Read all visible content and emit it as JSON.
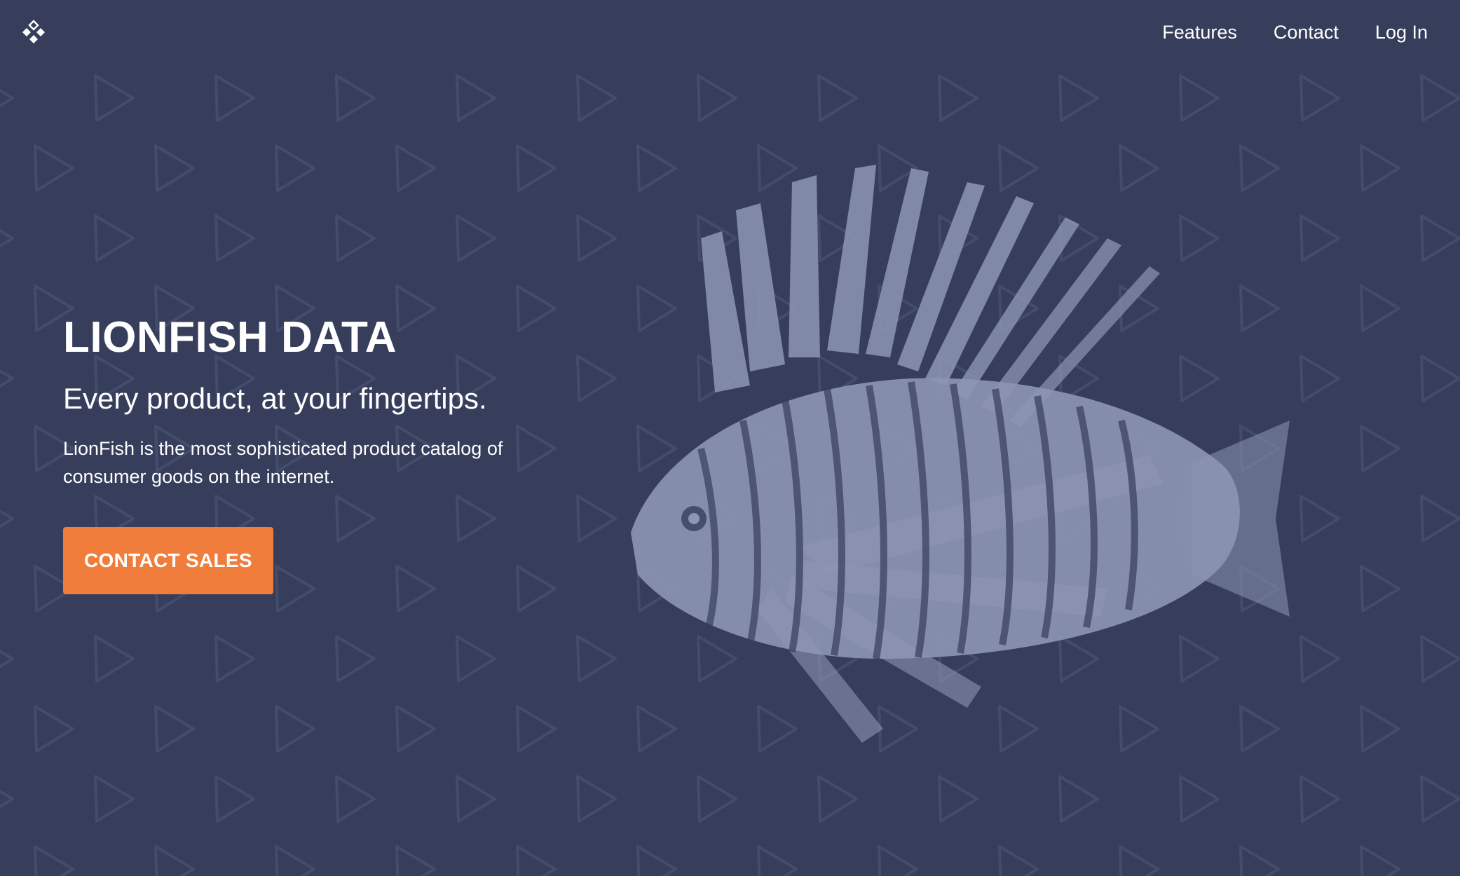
{
  "header": {
    "logo_icon": "diamond-cluster-logo-icon",
    "nav": {
      "features": "Features",
      "contact": "Contact",
      "login": "Log In"
    }
  },
  "hero": {
    "title": "LIONFISH DATA",
    "subtitle": "Every product, at your fingertips.",
    "description": "LionFish is the most sophisticated product catalog of consumer goods on the internet.",
    "cta_label": "CONTACT SALES",
    "illustration": "lionfish-illustration"
  },
  "colors": {
    "background": "#363e5b",
    "accent": "#f07d3b",
    "text": "#ffffff",
    "pattern": "#3f4866",
    "fish": "#8d96b3"
  }
}
